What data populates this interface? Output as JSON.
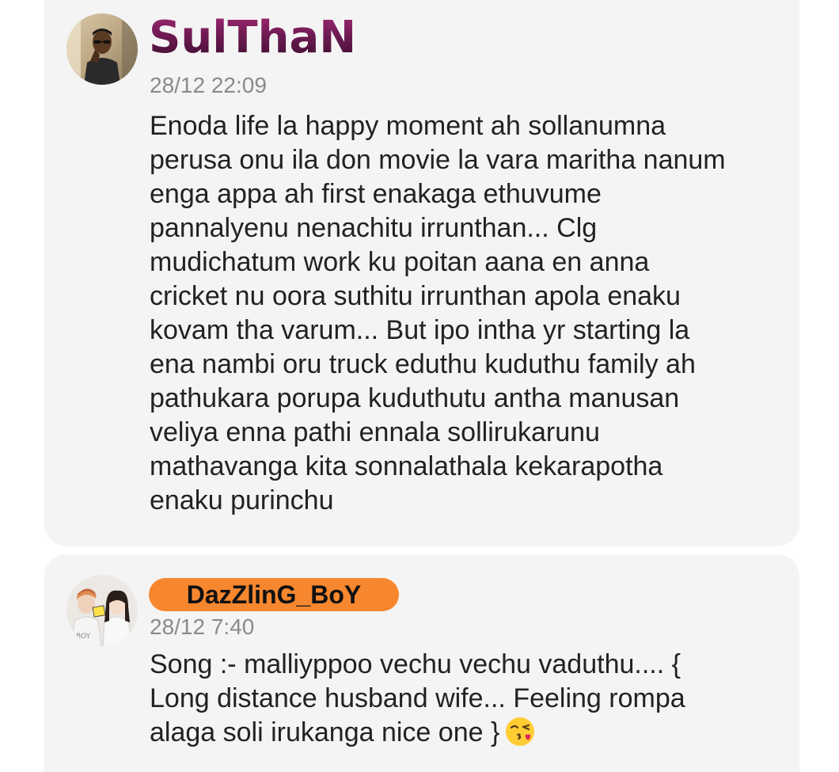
{
  "comments": [
    {
      "author": "SulThaN",
      "timestamp": "28/12 22:09",
      "text": "Enoda life la happy moment ah sollanumna\nperusa onu ila don movie la vara maritha nanum\nenga appa ah first enakaga ethuvume\npannalyenu nenachitu irrunthan... Clg\nmudichatum work ku poitan aana en anna\ncricket nu oora suthitu irrunthan apola enaku\nkovam tha varum... But ipo intha yr starting la\nena nambi oru truck eduthu kuduthu family ah\npathukara porupa kuduthutu antha manusan\nveliya enna pathi ennala sollirukarunu\nmathavanga kita sonnalathala kekarapotha\nenaku purinchu",
      "avatar_icon": "user-avatar-photo",
      "name_color": "#7a1d5a"
    },
    {
      "author": "DazZlinG_BoY",
      "timestamp": "28/12 7:40",
      "text": "Song :- malliyppoo vechu vechu vaduthu.... {\nLong distance husband wife... Feeling rompa\nalaga soli irukanga nice one }",
      "emoji_icon": "face-blowing-kiss-emoji",
      "avatar_icon": "couple-avatar-photo",
      "name_badge_color": "#f7872f"
    }
  ],
  "colors": {
    "card_background": "#f4f4f4",
    "timestamp": "#8a8a8a",
    "body_text": "#222222"
  }
}
